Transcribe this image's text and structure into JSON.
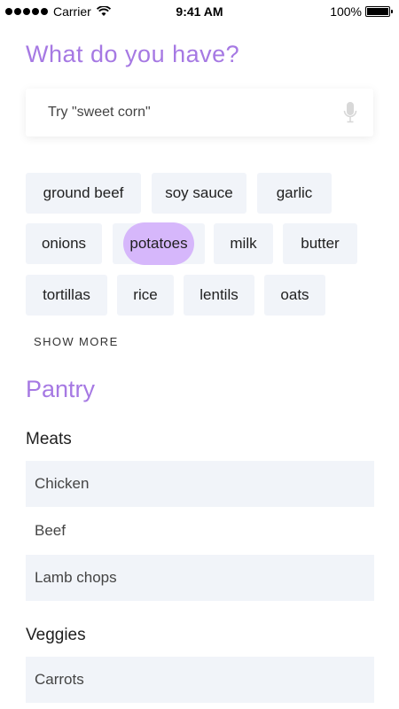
{
  "status_bar": {
    "carrier": "Carrier",
    "time": "9:41 AM",
    "battery": "100%"
  },
  "title": "What do you have?",
  "search": {
    "placeholder": "Try \"sweet corn\""
  },
  "ingredients": [
    "ground beef",
    "soy sauce",
    "garlic",
    "onions",
    "potatoes",
    "milk",
    "butter",
    "tortillas",
    "rice",
    "lentils",
    "oats"
  ],
  "selected_ingredient": "potatoes",
  "show_more_label": "SHOW MORE",
  "pantry": {
    "title": "Pantry",
    "groups": [
      {
        "name": "Meats",
        "items": [
          "Chicken",
          "Beef",
          "Lamb chops"
        ]
      },
      {
        "name": "Veggies",
        "items": [
          "Carrots"
        ]
      }
    ]
  },
  "colors": {
    "accent": "#a679e3",
    "chip_bg": "#f1f4f9",
    "chip_selected": "#d6b7fb"
  }
}
